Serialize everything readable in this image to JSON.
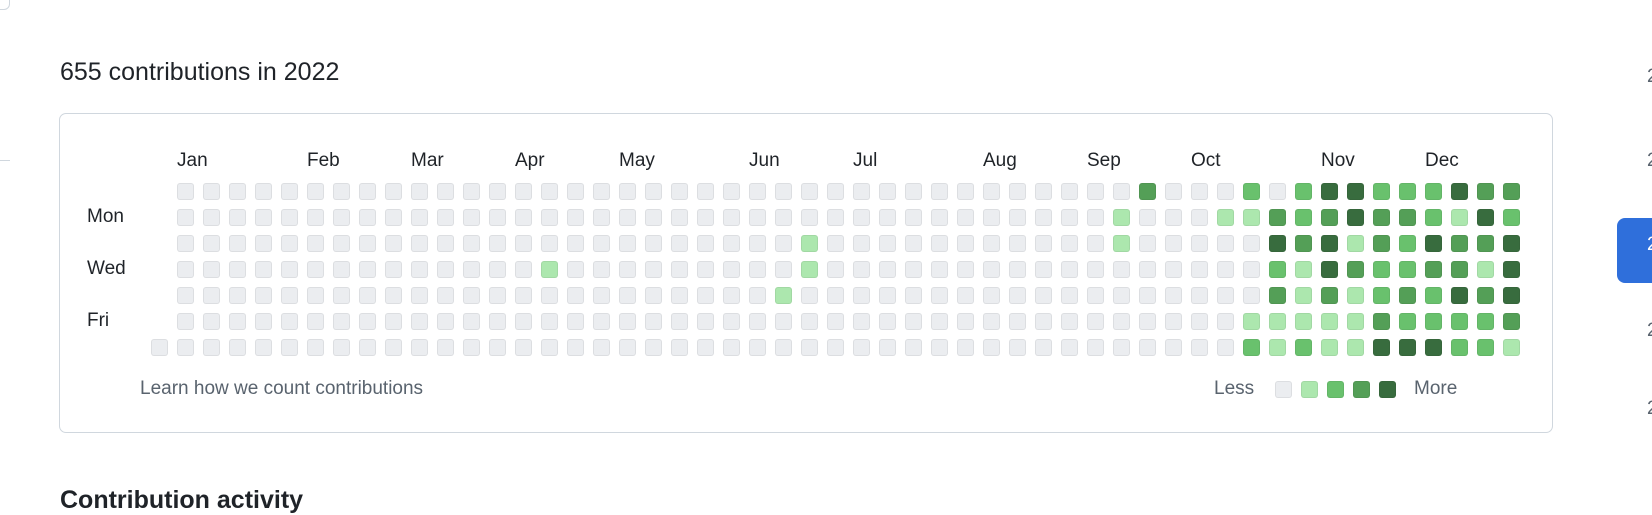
{
  "header": {
    "title": "655 contributions in 2022"
  },
  "months": [
    {
      "label": "Jan",
      "week": 1
    },
    {
      "label": "Feb",
      "week": 6
    },
    {
      "label": "Mar",
      "week": 10
    },
    {
      "label": "Apr",
      "week": 14
    },
    {
      "label": "May",
      "week": 18
    },
    {
      "label": "Jun",
      "week": 23
    },
    {
      "label": "Jul",
      "week": 27
    },
    {
      "label": "Aug",
      "week": 32
    },
    {
      "label": "Sep",
      "week": 36
    },
    {
      "label": "Oct",
      "week": 40
    },
    {
      "label": "Nov",
      "week": 45
    },
    {
      "label": "Dec",
      "week": 49
    }
  ],
  "days": [
    {
      "label": "Mon",
      "row": 1
    },
    {
      "label": "Wed",
      "row": 3
    },
    {
      "label": "Fri",
      "row": 5
    }
  ],
  "grid": [
    "-0000000000000000000000000000000000000300020244222433",
    "-000000000000000000000000000000000000100011323433214 2",
    "-000000000000000000000000100000000000100000434132433 4",
    "-000000000000001000000000100000000000000000214322331 4",
    "-000000000000000000000001000000000000000000313123243 4",
    "-000000000000000000000000000000000000000001111132222 3",
    "000000000000000000000000000000000000000000212114442 21"
  ],
  "level_colors": [
    "#ebedf0",
    "#ace7ae",
    "#69c16d",
    "#549f57",
    "#386c3e"
  ],
  "footer": {
    "learn_link": "Learn how we count contributions",
    "less": "Less",
    "more": "More"
  },
  "years": [
    "2",
    "2",
    "2",
    "2",
    "2"
  ],
  "active_year_index": 2,
  "next_section": "Contribution activity"
}
